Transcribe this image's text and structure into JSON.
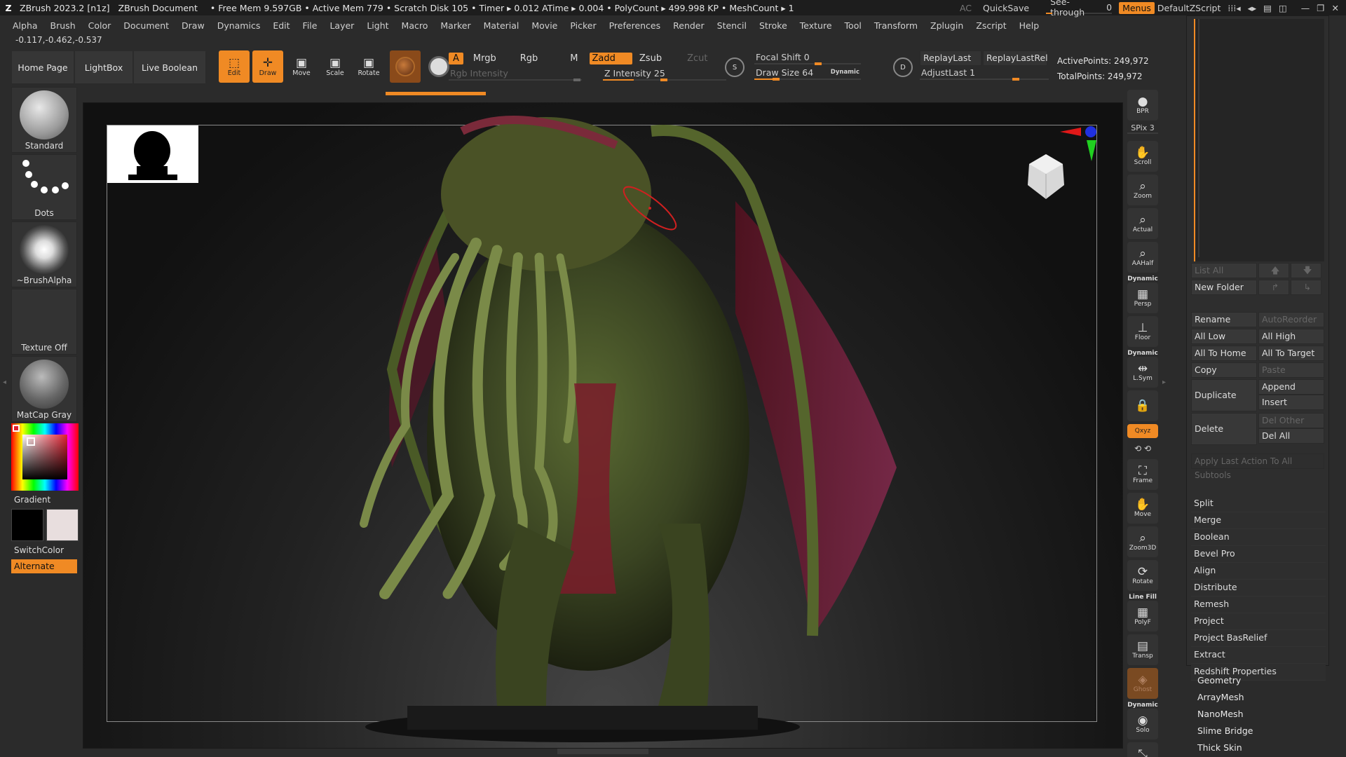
{
  "titlebar": {
    "app": "ZBrush 2023.2 [n1z]",
    "document": "ZBrush Document",
    "stats": "• Free Mem 9.597GB • Active Mem 779 • Scratch Disk 105 • Timer ▸ 0.012 ATime ▸ 0.004 • PolyCount ▸ 499.998 KP • MeshCount ▸ 1",
    "ac": "AC",
    "quicksave": "QuickSave",
    "see_through_label": "See-through",
    "see_through_value": "0",
    "see_through_fraction": 0.1,
    "menus": "Menus",
    "script": "DefaultZScript"
  },
  "menubar": [
    "Alpha",
    "Brush",
    "Color",
    "Document",
    "Draw",
    "Dynamics",
    "Edit",
    "File",
    "Layer",
    "Light",
    "Macro",
    "Marker",
    "Material",
    "Movie",
    "Picker",
    "Preferences",
    "Render",
    "Stencil",
    "Stroke",
    "Texture",
    "Tool",
    "Transform",
    "Zplugin",
    "Zscript",
    "Help"
  ],
  "coords": "-0.117,-0.462,-0.537",
  "toolbar": {
    "home_page": "Home Page",
    "lightbox": "LightBox",
    "live_boolean": "Live Boolean",
    "edit": "Edit",
    "draw": "Draw",
    "move": "Move",
    "scale": "Scale",
    "rotate": "Rotate",
    "a": "A",
    "mrgb": "Mrgb",
    "rgb": "Rgb",
    "m": "M",
    "zadd": "Zadd",
    "zsub": "Zsub",
    "zcut": "Zcut",
    "rgb_intensity": "Rgb Intensity",
    "z_intensity": "Z Intensity 25",
    "focal_shift": "Focal Shift 0",
    "draw_size": "Draw Size 64",
    "dynamic": "Dynamic",
    "replay_last": "ReplayLast",
    "replay_last_rel": "ReplayLastRel",
    "adjust_last": "AdjustLast 1",
    "active_points": "ActivePoints: 249,972",
    "total_points": "TotalPoints: 249,972",
    "icon_s": "S",
    "icon_d": "D"
  },
  "left_shelf": {
    "brush": "Standard",
    "stroke": "Dots",
    "alpha": "~BrushAlpha",
    "texture": "Texture Off",
    "material": "MatCap Gray",
    "gradient": "Gradient",
    "switch_color": "SwitchColor",
    "alternate": "Alternate"
  },
  "right_shelf": [
    {
      "id": "bpr",
      "label": "BPR",
      "icon": "sphere-icon"
    },
    {
      "id": "spix",
      "label": "SPix 3"
    },
    {
      "id": "scroll",
      "label": "Scroll",
      "icon": "hand-icon"
    },
    {
      "id": "zoom",
      "label": "Zoom",
      "icon": "magnifier-icon"
    },
    {
      "id": "actual",
      "label": "Actual",
      "icon": "magnifier-icon"
    },
    {
      "id": "aahalf",
      "label": "AAHalf",
      "icon": "magnifier-icon"
    },
    {
      "id": "persp",
      "label": "Persp",
      "top": "Dynamic",
      "icon": "grid-icon"
    },
    {
      "id": "floor",
      "label": "Floor",
      "icon": "floor-icon"
    },
    {
      "id": "lsym",
      "label": "L.Sym",
      "top": "Dynamic",
      "icon": "symmetry-icon"
    },
    {
      "id": "lock",
      "label": "",
      "icon": "lock-icon"
    },
    {
      "id": "xyz",
      "label": "Qxyz",
      "icon": "xyz-icon"
    },
    {
      "id": "frame",
      "label": "Frame",
      "icon": "frame-icon"
    },
    {
      "id": "move",
      "label": "Move",
      "icon": "hand-icon"
    },
    {
      "id": "zoom3d",
      "label": "Zoom3D",
      "icon": "magnifier-icon"
    },
    {
      "id": "rotate",
      "label": "Rotate",
      "icon": "rotate-icon"
    },
    {
      "id": "polyf",
      "label": "PolyF",
      "top": "Line Fill",
      "icon": "grid-icon"
    },
    {
      "id": "transp",
      "label": "Transp",
      "icon": "layers-icon"
    },
    {
      "id": "ghost",
      "label": "Ghost",
      "icon": "ghost-icon"
    },
    {
      "id": "solo",
      "label": "Solo",
      "top": "Dynamic",
      "icon": "solo-icon"
    },
    {
      "id": "xpose",
      "label": "Xpose",
      "icon": "xpose-icon"
    }
  ],
  "subtool": {
    "list_all": "List All",
    "new_folder": "New Folder",
    "rename": "Rename",
    "auto_reorder": "AutoReorder",
    "all_low": "All Low",
    "all_high": "All High",
    "all_to_home": "All To Home",
    "all_to_target": "All To Target",
    "copy": "Copy",
    "paste": "Paste",
    "duplicate": "Duplicate",
    "append": "Append",
    "insert": "Insert",
    "delete": "Delete",
    "del_other": "Del Other",
    "del_all": "Del All",
    "apply_last": "Apply Last Action To All Subtools",
    "list": [
      "Split",
      "Merge",
      "Boolean",
      "Bevel Pro",
      "Align",
      "Distribute",
      "Remesh",
      "Project",
      "Project BasRelief",
      "Extract",
      "Redshift Properties"
    ]
  },
  "tool_palette": [
    "Geometry",
    "ArrayMesh",
    "NanoMesh",
    "Slime Bridge",
    "Thick Skin"
  ],
  "colors": {
    "accent": "#f08a24",
    "main_color": "#000000",
    "secondary_color": "#e8dede"
  }
}
